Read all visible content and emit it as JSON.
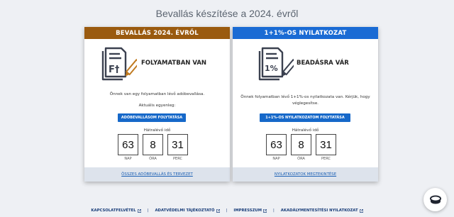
{
  "page": {
    "title": "Bevallás készítése a 2024. évről"
  },
  "cards": [
    {
      "header": "BEVALLÁS 2024. ÉVRŐL",
      "header_color": "#9a5a0f",
      "icon": "tax-form-icon",
      "status": "FOLYAMATBAN VAN",
      "description": "Önnek van egy folyamatban lévő adóbevallása.",
      "balance_label": "Aktuális egyenleg:",
      "button": "ADÓBEVALLÁSOM FOLYTATÁSA",
      "remaining_label": "Hátralévő idő",
      "countdown": [
        {
          "value": "63",
          "unit": "NAP"
        },
        {
          "value": "8",
          "unit": "ÓRA"
        },
        {
          "value": "31",
          "unit": "PERC"
        }
      ],
      "footer_link": "ÖSSZES ADÓBEVALLÁS ÉS TERVEZET"
    },
    {
      "header": "1+1%-OS NYILATKOZAT",
      "header_color": "#1a6bd4",
      "icon": "percent-form-icon",
      "status": "BEADÁSRA VÁR",
      "description": "Önnek folyamatban lévő 1+1%-os nyilatkozata van. Kérjük, hogy véglegesítse.",
      "button": "1+1%-OS NYILATKOZATOM FOLYTATÁSA",
      "remaining_label": "Hátralévő idő",
      "countdown": [
        {
          "value": "63",
          "unit": "NAP"
        },
        {
          "value": "8",
          "unit": "ÓRA"
        },
        {
          "value": "31",
          "unit": "PERC"
        }
      ],
      "footer_link": "NYILATKOZATOK MEGTEKINTÉSE"
    }
  ],
  "footer": {
    "links": [
      "KAPCSOLATFELVÉTEL",
      "ADATVÉDELMI TÁJÉKOZTATÓ",
      "IMPRESSZUM",
      "AKADÁLYMENTESÍTÉSI NYILATKOZAT"
    ],
    "separator": "|",
    "link_icon": "external-link-icon"
  },
  "chat_button": {
    "icon": "chat-icon"
  }
}
